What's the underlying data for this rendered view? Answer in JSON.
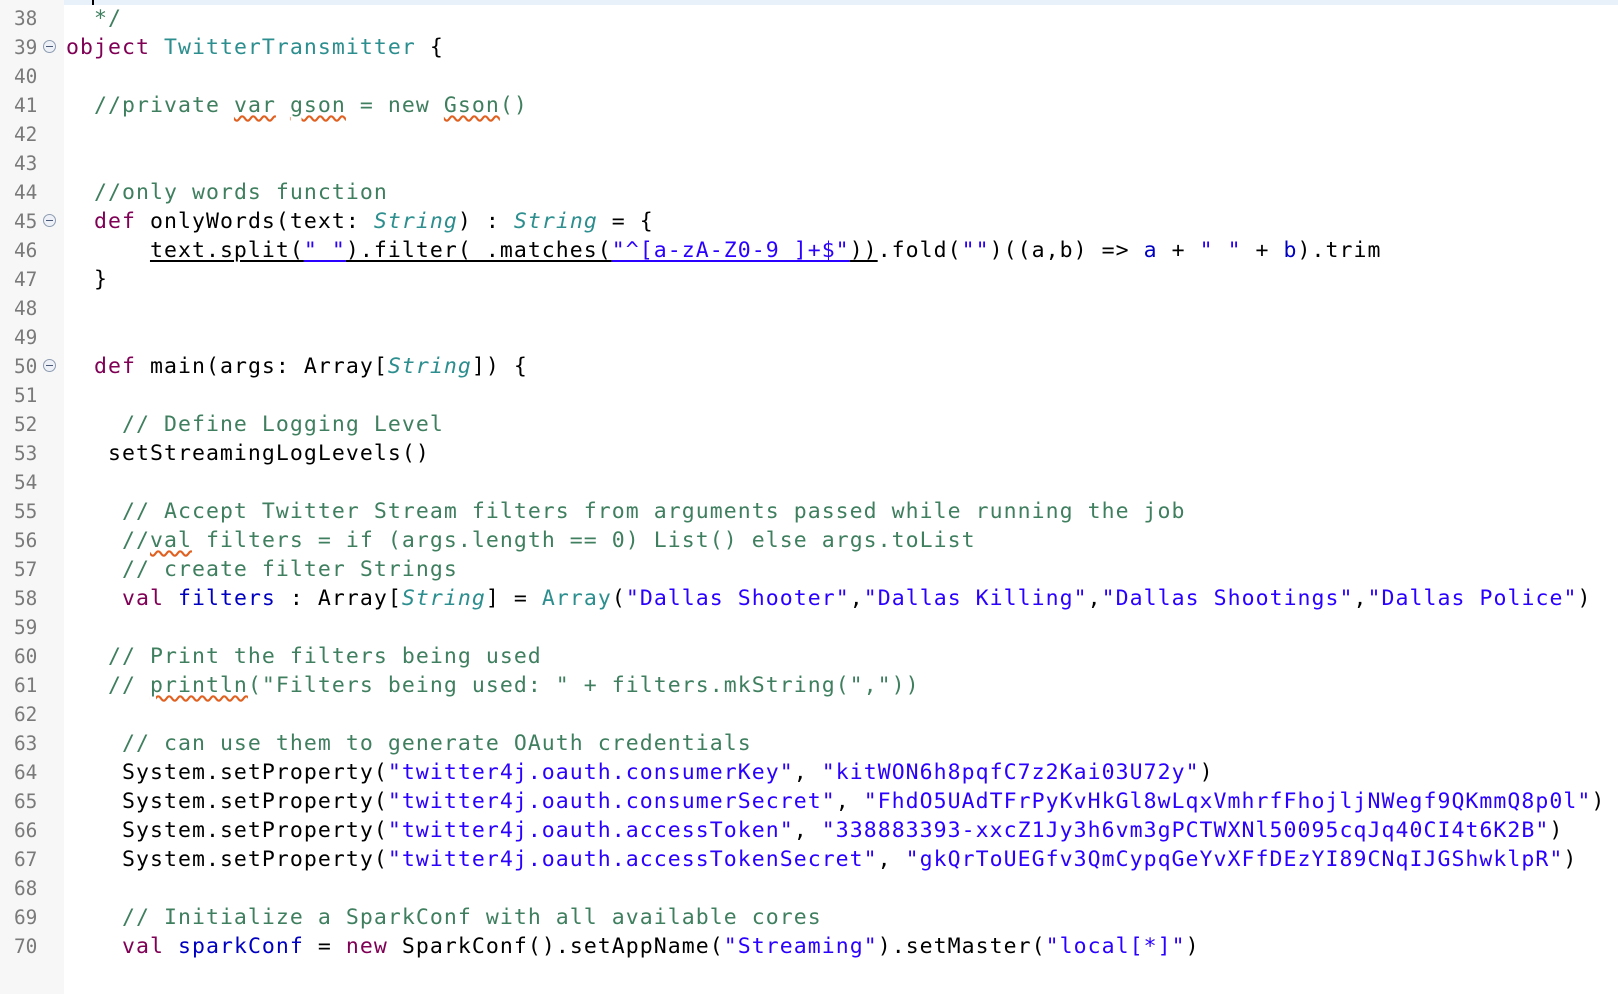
{
  "editor": {
    "lines": [
      {
        "n": "38",
        "fold": false,
        "indent": "  ",
        "tokens": [
          {
            "t": "*/",
            "c": "cmt"
          }
        ]
      },
      {
        "n": "39",
        "fold": true,
        "indent": "",
        "tokens": [
          {
            "t": "object ",
            "c": "kw"
          },
          {
            "t": "TwitterTransmitter",
            "c": "ty"
          },
          {
            "t": " {"
          }
        ]
      },
      {
        "n": "40",
        "fold": false,
        "indent": "",
        "tokens": []
      },
      {
        "n": "41",
        "fold": false,
        "indent": "  ",
        "tokens": [
          {
            "t": "//private ",
            "c": "cmt"
          },
          {
            "t": "var",
            "c": "cmt sq"
          },
          {
            "t": " ",
            "c": "cmt"
          },
          {
            "t": "gson",
            "c": "cmt sq"
          },
          {
            "t": " = new ",
            "c": "cmt"
          },
          {
            "t": "Gson",
            "c": "cmt sq"
          },
          {
            "t": "()",
            "c": "cmt"
          }
        ]
      },
      {
        "n": "42",
        "fold": false,
        "indent": "",
        "tokens": []
      },
      {
        "n": "43",
        "fold": false,
        "indent": "",
        "tokens": []
      },
      {
        "n": "44",
        "fold": false,
        "indent": "  ",
        "tokens": [
          {
            "t": "//only words function",
            "c": "cmt"
          }
        ]
      },
      {
        "n": "45",
        "fold": true,
        "indent": "  ",
        "tokens": [
          {
            "t": "def ",
            "c": "kw"
          },
          {
            "t": "onlyWords(text: "
          },
          {
            "t": "String",
            "c": "tyi"
          },
          {
            "t": ") : "
          },
          {
            "t": "String",
            "c": "tyi"
          },
          {
            "t": " = {"
          }
        ]
      },
      {
        "n": "46",
        "fold": false,
        "indent": "      ",
        "tokens": [
          {
            "t": "text.split(",
            "c": "ul"
          },
          {
            "t": "\" \"",
            "c": "str ul"
          },
          {
            "t": ").filter(_.matches(",
            "c": "ul"
          },
          {
            "t": "\"^[a-zA-Z0-9 ]+$\"",
            "c": "str ul"
          },
          {
            "t": "))",
            "c": "ul"
          },
          {
            "t": ".fold("
          },
          {
            "t": "\"\"",
            "c": "str"
          },
          {
            "t": ")((a,b) => "
          },
          {
            "t": "a",
            "c": "fld"
          },
          {
            "t": " + "
          },
          {
            "t": "\" \"",
            "c": "str"
          },
          {
            "t": " + "
          },
          {
            "t": "b",
            "c": "fld"
          },
          {
            "t": ").trim"
          }
        ]
      },
      {
        "n": "47",
        "fold": false,
        "indent": "  ",
        "tokens": [
          {
            "t": "}"
          }
        ]
      },
      {
        "n": "48",
        "fold": false,
        "indent": "",
        "tokens": []
      },
      {
        "n": "49",
        "fold": false,
        "indent": "",
        "tokens": []
      },
      {
        "n": "50",
        "fold": true,
        "indent": "  ",
        "tokens": [
          {
            "t": "def ",
            "c": "kw"
          },
          {
            "t": "main(args: Array["
          },
          {
            "t": "String",
            "c": "tyi"
          },
          {
            "t": "]) {"
          }
        ]
      },
      {
        "n": "51",
        "fold": false,
        "indent": "",
        "tokens": []
      },
      {
        "n": "52",
        "fold": false,
        "indent": "    ",
        "tokens": [
          {
            "t": "// Define Logging Level",
            "c": "cmt"
          }
        ]
      },
      {
        "n": "53",
        "fold": false,
        "indent": "   ",
        "tokens": [
          {
            "t": "setStreamingLogLevels()"
          }
        ]
      },
      {
        "n": "54",
        "fold": false,
        "indent": "",
        "tokens": []
      },
      {
        "n": "55",
        "fold": false,
        "indent": "    ",
        "tokens": [
          {
            "t": "// Accept Twitter Stream filters from arguments passed while running the job",
            "c": "cmt"
          }
        ]
      },
      {
        "n": "56",
        "fold": false,
        "indent": "    ",
        "tokens": [
          {
            "t": "//",
            "c": "cmt"
          },
          {
            "t": "val",
            "c": "cmt sq"
          },
          {
            "t": " filters = if (args.length == 0) List() else args.toList",
            "c": "cmt"
          }
        ]
      },
      {
        "n": "57",
        "fold": false,
        "indent": "    ",
        "tokens": [
          {
            "t": "// create filter Strings",
            "c": "cmt"
          }
        ]
      },
      {
        "n": "58",
        "fold": false,
        "indent": "    ",
        "tokens": [
          {
            "t": "val ",
            "c": "kw"
          },
          {
            "t": "filters",
            "c": "fld"
          },
          {
            "t": " : Array["
          },
          {
            "t": "String",
            "c": "tyi"
          },
          {
            "t": "] = "
          },
          {
            "t": "Array",
            "c": "ty"
          },
          {
            "t": "("
          },
          {
            "t": "\"Dallas Shooter\"",
            "c": "str"
          },
          {
            "t": ","
          },
          {
            "t": "\"Dallas Killing\"",
            "c": "str"
          },
          {
            "t": ","
          },
          {
            "t": "\"Dallas Shootings\"",
            "c": "str"
          },
          {
            "t": ","
          },
          {
            "t": "\"Dallas Police\"",
            "c": "str"
          },
          {
            "t": ")"
          }
        ]
      },
      {
        "n": "59",
        "fold": false,
        "indent": "",
        "tokens": []
      },
      {
        "n": "60",
        "fold": false,
        "indent": "   ",
        "tokens": [
          {
            "t": "// Print the filters being used",
            "c": "cmt"
          }
        ]
      },
      {
        "n": "61",
        "fold": false,
        "indent": "   ",
        "tokens": [
          {
            "t": "// ",
            "c": "cmt"
          },
          {
            "t": "println",
            "c": "cmt sq"
          },
          {
            "t": "(\"Filters being used: \" + filters.mkString(\",\"))",
            "c": "cmt"
          }
        ]
      },
      {
        "n": "62",
        "fold": false,
        "indent": "",
        "tokens": []
      },
      {
        "n": "63",
        "fold": false,
        "indent": "    ",
        "tokens": [
          {
            "t": "// can use them to generate OAuth credentials",
            "c": "cmt"
          }
        ]
      },
      {
        "n": "64",
        "fold": false,
        "indent": "    ",
        "tokens": [
          {
            "t": "System.setProperty("
          },
          {
            "t": "\"twitter4j.oauth.consumerKey\"",
            "c": "str"
          },
          {
            "t": ", "
          },
          {
            "t": "\"kitWON6h8pqfC7z2Kai03U72y\"",
            "c": "str"
          },
          {
            "t": ")"
          }
        ]
      },
      {
        "n": "65",
        "fold": false,
        "indent": "    ",
        "tokens": [
          {
            "t": "System.setProperty("
          },
          {
            "t": "\"twitter4j.oauth.consumerSecret\"",
            "c": "str"
          },
          {
            "t": ", "
          },
          {
            "t": "\"FhdO5UAdTFrPyKvHkGl8wLqxVmhrfFhojljNWegf9QKmmQ8p0l\"",
            "c": "str"
          },
          {
            "t": ")"
          }
        ]
      },
      {
        "n": "66",
        "fold": false,
        "indent": "    ",
        "tokens": [
          {
            "t": "System.setProperty("
          },
          {
            "t": "\"twitter4j.oauth.accessToken\"",
            "c": "str"
          },
          {
            "t": ", "
          },
          {
            "t": "\"338883393-xxcZ1Jy3h6vm3gPCTWXNl50095cqJq40CI4t6K2B\"",
            "c": "str"
          },
          {
            "t": ")"
          }
        ]
      },
      {
        "n": "67",
        "fold": false,
        "indent": "    ",
        "tokens": [
          {
            "t": "System.setProperty("
          },
          {
            "t": "\"twitter4j.oauth.accessTokenSecret\"",
            "c": "str"
          },
          {
            "t": ", "
          },
          {
            "t": "\"gkQrToUEGfv3QmCypqGeYvXFfDEzYI89CNqIJGShwklpR\"",
            "c": "str"
          },
          {
            "t": ")"
          }
        ]
      },
      {
        "n": "68",
        "fold": false,
        "indent": "",
        "tokens": []
      },
      {
        "n": "69",
        "fold": false,
        "indent": "    ",
        "tokens": [
          {
            "t": "// Initialize a SparkConf with all available cores",
            "c": "cmt"
          }
        ]
      },
      {
        "n": "70",
        "fold": false,
        "indent": "    ",
        "tokens": [
          {
            "t": "val ",
            "c": "kw"
          },
          {
            "t": "sparkConf",
            "c": "fld"
          },
          {
            "t": " = "
          },
          {
            "t": "new ",
            "c": "kw"
          },
          {
            "t": "SparkConf().setAppName("
          },
          {
            "t": "\"Streaming\"",
            "c": "str"
          },
          {
            "t": ").setMaster("
          },
          {
            "t": "\"local[*]\"",
            "c": "str"
          },
          {
            "t": ")"
          }
        ]
      }
    ]
  }
}
